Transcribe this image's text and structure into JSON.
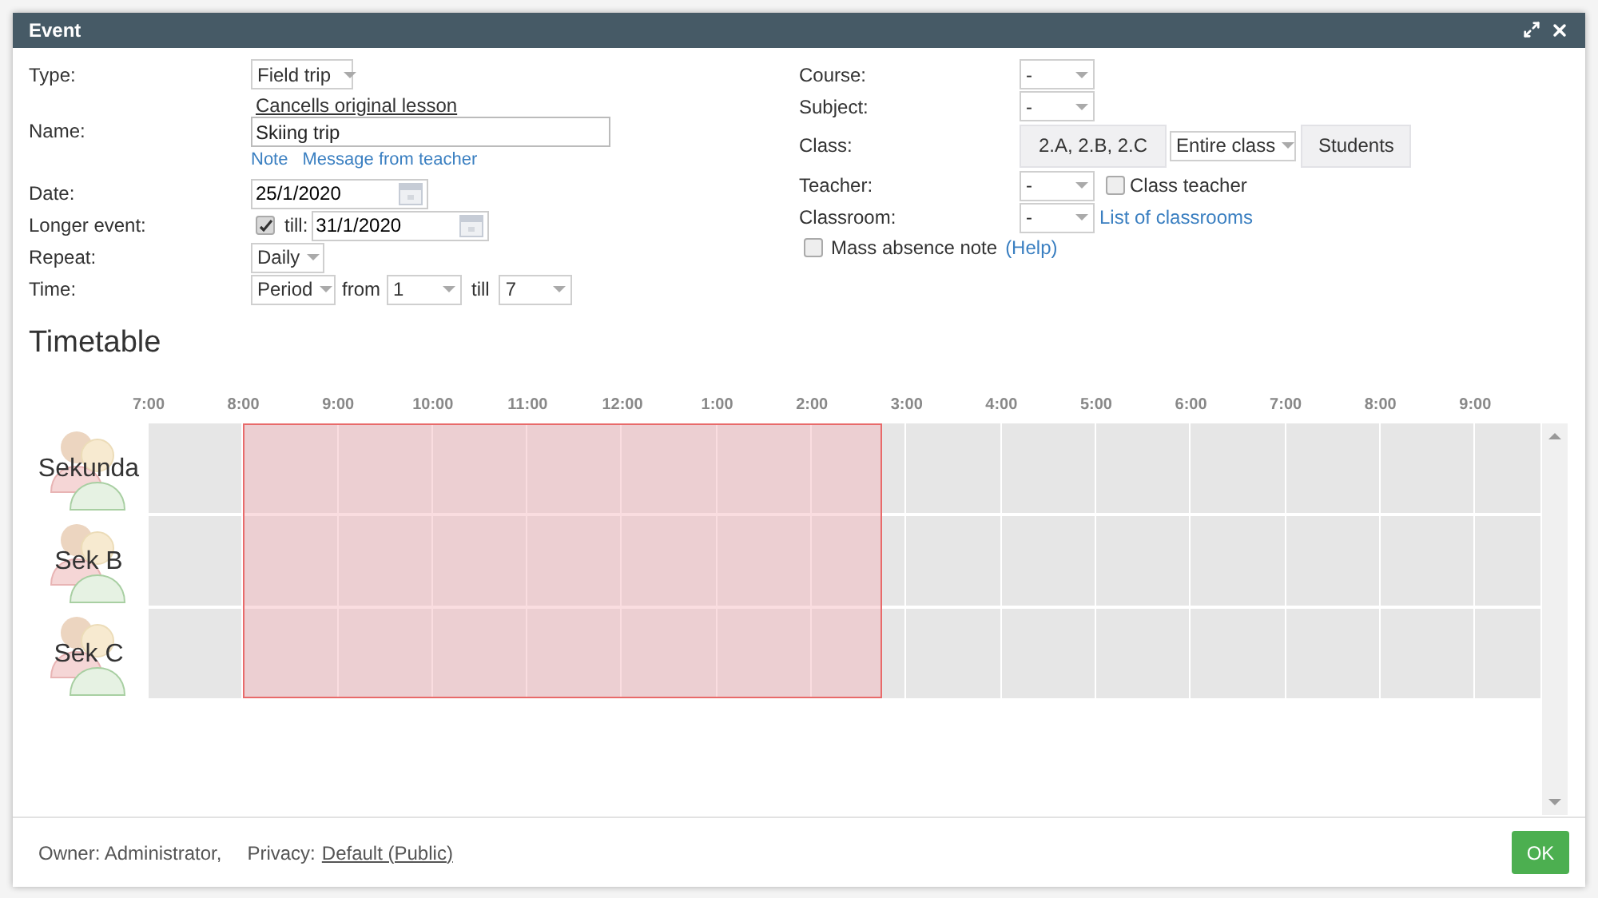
{
  "window": {
    "title": "Event"
  },
  "form_left": {
    "type": {
      "label": "Type:",
      "value": "Field trip",
      "link": "Cancells original lesson"
    },
    "name": {
      "label": "Name:",
      "value": "Skiing trip",
      "links": [
        "Note",
        "Message from teacher"
      ]
    },
    "date": {
      "label": "Date:",
      "value": "25/1/2020"
    },
    "longer_event": {
      "label": "Longer event:",
      "checked": true,
      "till_label": "till:",
      "till_value": "31/1/2020"
    },
    "repeat": {
      "label": "Repeat:",
      "value": "Daily"
    },
    "time": {
      "label": "Time:",
      "mode": "Period",
      "from_label": "from",
      "from": "1",
      "till_label": "till",
      "till": "7"
    }
  },
  "form_right": {
    "course": {
      "label": "Course:",
      "value": "-"
    },
    "subject": {
      "label": "Subject:",
      "value": "-"
    },
    "class": {
      "label": "Class:",
      "classes": "2.A, 2.B, 2.C",
      "scope": "Entire class",
      "students_button": "Students"
    },
    "teacher": {
      "label": "Teacher:",
      "value": "-",
      "class_teacher": {
        "label": "Class teacher",
        "checked": false
      }
    },
    "classroom": {
      "label": "Classroom:",
      "value": "-",
      "link": "List of classrooms"
    },
    "mass_absence": {
      "label": "Mass absence note",
      "checked": false,
      "help": "(Help)"
    }
  },
  "timetable": {
    "title": "Timetable",
    "hours": [
      "7:00",
      "8:00",
      "9:00",
      "10:00",
      "11:00",
      "12:00",
      "1:00",
      "2:00",
      "3:00",
      "4:00",
      "5:00",
      "6:00",
      "7:00",
      "8:00",
      "9:00"
    ],
    "groups": [
      {
        "name": "Sekunda"
      },
      {
        "name": "Sek B"
      },
      {
        "name": "Sek C"
      }
    ]
  },
  "footer": {
    "owner": "Owner: Administrator,",
    "privacy_label": "Privacy:",
    "privacy_value": "Default (Public)",
    "ok": "OK"
  }
}
